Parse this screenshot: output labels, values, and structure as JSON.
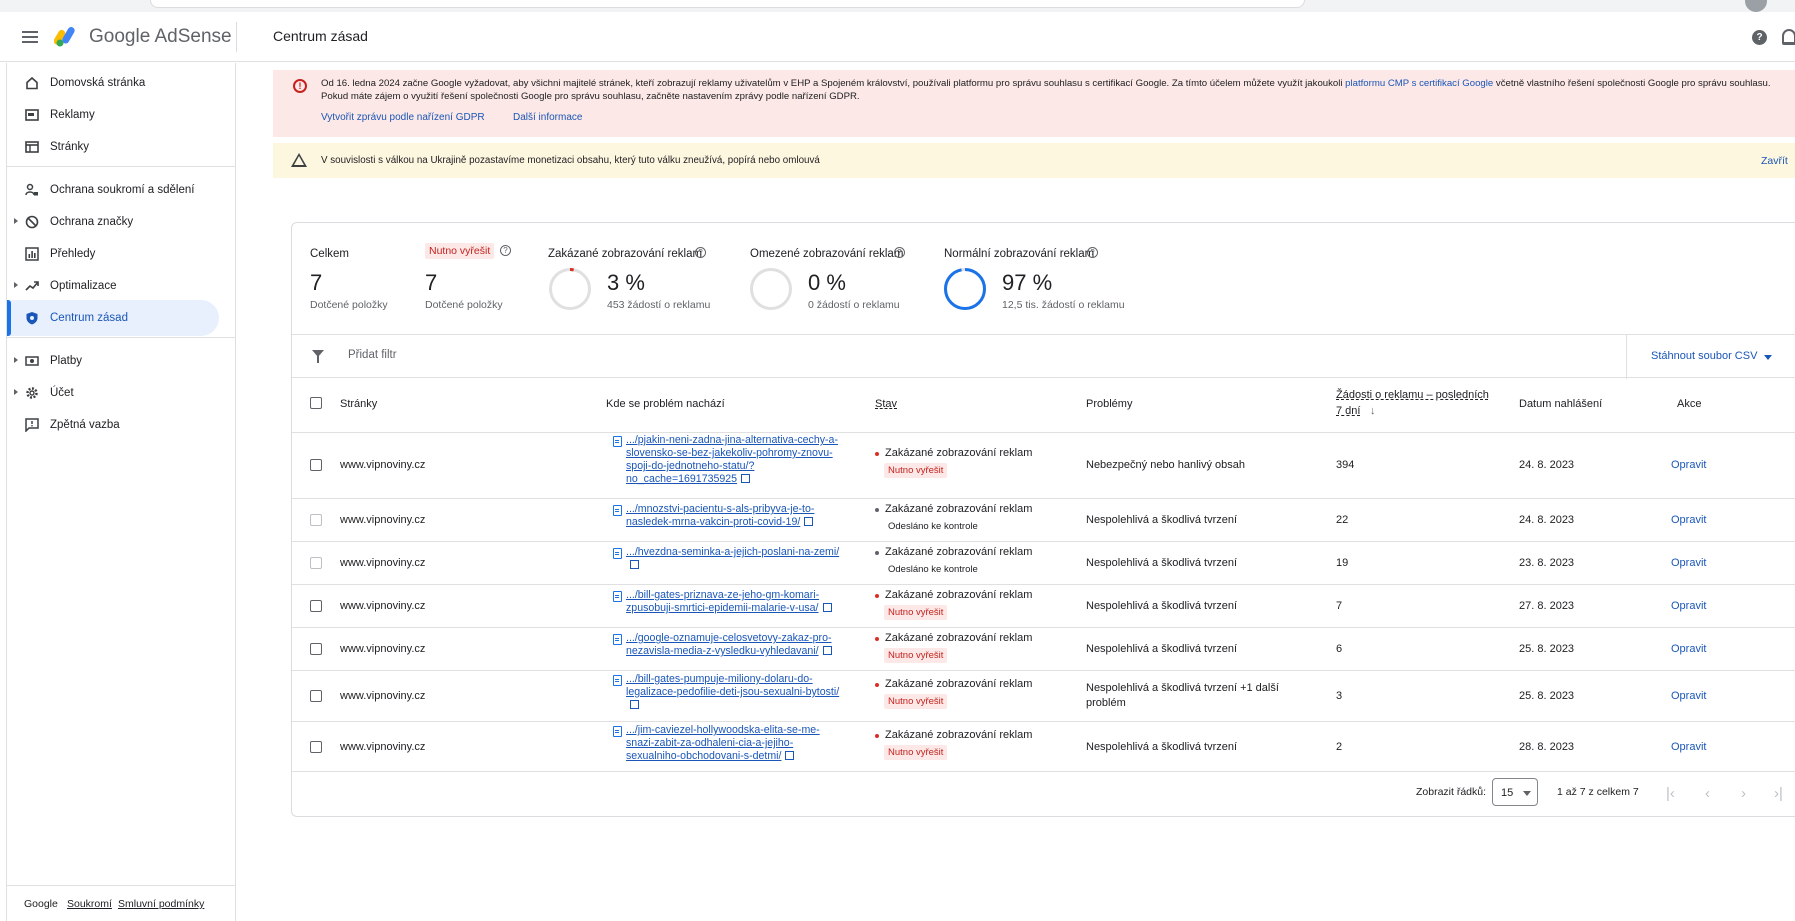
{
  "header": {
    "brand": "Google AdSense",
    "page_title": "Centrum zásad",
    "help_glyph": "?"
  },
  "sidebar": {
    "items": [
      {
        "label": "Domovská stránka",
        "icon": "home-icon"
      },
      {
        "label": "Reklamy",
        "icon": "ads-icon"
      },
      {
        "label": "Stránky",
        "icon": "sites-icon"
      },
      {
        "label": "Ochrana soukromí a sdělení",
        "icon": "privacy-icon"
      },
      {
        "label": "Ochrana značky",
        "icon": "block-icon"
      },
      {
        "label": "Přehledy",
        "icon": "reports-icon"
      },
      {
        "label": "Optimalizace",
        "icon": "trending-icon"
      },
      {
        "label": "Centrum zásad",
        "icon": "shield-icon"
      },
      {
        "label": "Platby",
        "icon": "payments-icon"
      },
      {
        "label": "Účet",
        "icon": "gear-icon"
      },
      {
        "label": "Zpětná vazba",
        "icon": "feedback-icon"
      }
    ],
    "footer": {
      "google": "Google",
      "privacy": "Soukromí",
      "terms": "Smluvní podmínky"
    }
  },
  "alerts": {
    "gdpr": {
      "text_before": "Od 16. ledna 2024 začne Google vyžadovat, aby všichni majitelé stránek, kteří zobrazují reklamy uživatelům v EHP a Spojeném království, používali platformu pro správu souhlasu s certifikací Google. Za tímto účelem můžete využít jakoukoli ",
      "link": "platformu CMP s certifikací Google",
      "text_after": " včetně vlastního řešení společnosti Google pro správu souhlasu. Pokud máte zájem o využití řešení společnosti Google pro správu souhlasu, začněte nastavením zprávy podle nařízení GDPR.",
      "action1": "Vytvořit zprávu podle nařízení GDPR",
      "action2": "Další informace",
      "error_glyph": "!"
    },
    "ukraine": {
      "text": "V souvislosti s válkou na Ukrajině pozastavíme monetizaci obsahu, který tuto válku zneužívá, popírá nebo omlouvá",
      "close": "Zavřít"
    }
  },
  "stats": {
    "total": {
      "label": "Celkem",
      "value": "7",
      "sub": "Dotčené položky"
    },
    "must_fix": {
      "label": "Nutno vyřešit",
      "value": "7",
      "sub": "Dotčené položky"
    },
    "restricted_banned": {
      "label": "Zakázané zobrazování reklam",
      "value": "3 %",
      "sub": "453 žádostí o reklamu",
      "fraction": 0.03
    },
    "limited": {
      "label": "Omezené zobrazování reklam",
      "value": "0 %",
      "sub": "0 žádostí o reklamu",
      "fraction": 0.0
    },
    "normal": {
      "label": "Normální zobrazování reklam",
      "value": "97 %",
      "sub": "12,5 tis. žádostí o reklamu",
      "fraction": 0.97
    },
    "q_glyph": "?"
  },
  "colors": {
    "banned": "#d93025",
    "normal": "#1a73e8",
    "ring_bg": "#e0e0e0"
  },
  "filter": {
    "placeholder": "Přidat filtr",
    "csv": "Stáhnout soubor CSV"
  },
  "table": {
    "headers": {
      "site": "Stránky",
      "where": "Kde se problém nachází",
      "status": "Stav",
      "issues": "Problémy",
      "requests_1": "Žádosti o reklamu – posledních",
      "requests_2": "7 dní",
      "sort_arrow": "↓",
      "date": "Datum nahlášení",
      "action": "Akce"
    },
    "rows": [
      {
        "site": "www.vipnoviny.cz",
        "url": ".../pjakin-neni-zadna-jina-alternativa-cechy-a-slovensko-se-bez-jakekoliv-pohromy-znovu-spoji-do-jednotneho-statu/?no_cache=1691735925",
        "status": "Zakázané zobrazování reklam",
        "badge": "Nutno vyřešit",
        "issue": "Nebezpečný nebo hanlivý obsah",
        "requests": "394",
        "date": "24. 8. 2023",
        "action": "Opravit"
      },
      {
        "site": "www.vipnoviny.cz",
        "url": ".../mnozstvi-pacientu-s-als-pribyva-je-to-nasledek-mrna-vakcin-proti-covid-19/",
        "status": "Zakázané zobrazování reklam",
        "badge": "Odesláno ke kontrole",
        "issue": "Nespolehlivá a škodlivá tvrzení",
        "requests": "22",
        "date": "24. 8. 2023",
        "action": "Opravit"
      },
      {
        "site": "www.vipnoviny.cz",
        "url": ".../hvezdna-seminka-a-jejich-poslani-na-zemi/",
        "status": "Zakázané zobrazování reklam",
        "badge": "Odesláno ke kontrole",
        "issue": "Nespolehlivá a škodlivá tvrzení",
        "requests": "19",
        "date": "23. 8. 2023",
        "action": "Opravit"
      },
      {
        "site": "www.vipnoviny.cz",
        "url": ".../bill-gates-priznava-ze-jeho-gm-komari-zpusobuji-smrtici-epidemii-malarie-v-usa/",
        "status": "Zakázané zobrazování reklam",
        "badge": "Nutno vyřešit",
        "issue": "Nespolehlivá a škodlivá tvrzení",
        "requests": "7",
        "date": "27. 8. 2023",
        "action": "Opravit"
      },
      {
        "site": "www.vipnoviny.cz",
        "url": ".../google-oznamuje-celosvetovy-zakaz-pro-nezavisla-media-z-vysledku-vyhledavani/",
        "status": "Zakázané zobrazování reklam",
        "badge": "Nutno vyřešit",
        "issue": "Nespolehlivá a škodlivá tvrzení",
        "requests": "6",
        "date": "25. 8. 2023",
        "action": "Opravit"
      },
      {
        "site": "www.vipnoviny.cz",
        "url": ".../bill-gates-pumpuje-miliony-dolaru-do-legalizace-pedofilie-deti-jsou-sexualni-bytosti/",
        "status": "Zakázané zobrazování reklam",
        "badge": "Nutno vyřešit",
        "issue_1": "Nespolehlivá a škodlivá tvrzení +1 další",
        "issue_2": "problém",
        "requests": "3",
        "date": "25. 8. 2023",
        "action": "Opravit"
      },
      {
        "site": "www.vipnoviny.cz",
        "url": ".../jim-caviezel-hollywoodska-elita-se-me-snazi-zabit-za-odhaleni-cia-a-jejiho-sexualniho-obchodovani-s-detmi/",
        "status": "Zakázané zobrazování reklam",
        "badge": "Nutno vyřešit",
        "issue": "Nespolehlivá a škodlivá tvrzení",
        "requests": "2",
        "date": "28. 8. 2023",
        "action": "Opravit"
      }
    ]
  },
  "pagination": {
    "rows_label": "Zobrazit řádků:",
    "rows_value": "15",
    "range": "1 až 7 z celkem 7",
    "first": "|‹",
    "prev": "‹",
    "next": "›",
    "last": "›|"
  }
}
